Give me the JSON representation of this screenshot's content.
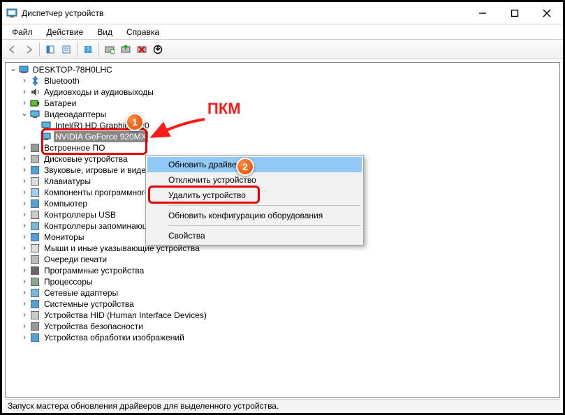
{
  "window": {
    "title": "Диспетчер устройств"
  },
  "menu": {
    "file": "Файл",
    "action": "Действие",
    "view": "Вид",
    "help": "Справка"
  },
  "tree": {
    "root": "DESKTOP-78H0LHC",
    "bluetooth": "Bluetooth",
    "audio": "Аудиовходы и аудиовыходы",
    "batteries": "Батареи",
    "display": "Видеоадаптеры",
    "intel": "Intel(R) HD Graphics 520",
    "nvidia": "NVIDIA GeForce 920MX",
    "firmware": "Встроенное ПО",
    "disks": "Дисковые устройства",
    "sound": "Звуковые, игровые и видеоустройства",
    "keyboards": "Клавиатуры",
    "software": "Компоненты программного обеспечения",
    "computer": "Компьютер",
    "usb": "Контроллеры USB",
    "storage": "Контроллеры запоминающих устройств",
    "monitors": "Мониторы",
    "mice": "Мыши и иные указывающие устройства",
    "printqueues": "Очереди печати",
    "swdev": "Программные устройства",
    "cpus": "Процессоры",
    "network": "Сетевые адаптеры",
    "system": "Системные устройства",
    "hid": "Устройства HID (Human Interface Devices)",
    "security": "Устройства безопасности",
    "imaging": "Устройства обработки изображений"
  },
  "ctx": {
    "update": "Обновить драйвер",
    "disable": "Отключить устройство",
    "uninstall": "Удалить устройство",
    "rescan": "Обновить конфигурацию оборудования",
    "properties": "Свойства"
  },
  "status": "Запуск мастера обновления драйверов для выделенного устройства.",
  "anno": {
    "rmb": "ПКМ",
    "m1": "1",
    "m2": "2"
  }
}
